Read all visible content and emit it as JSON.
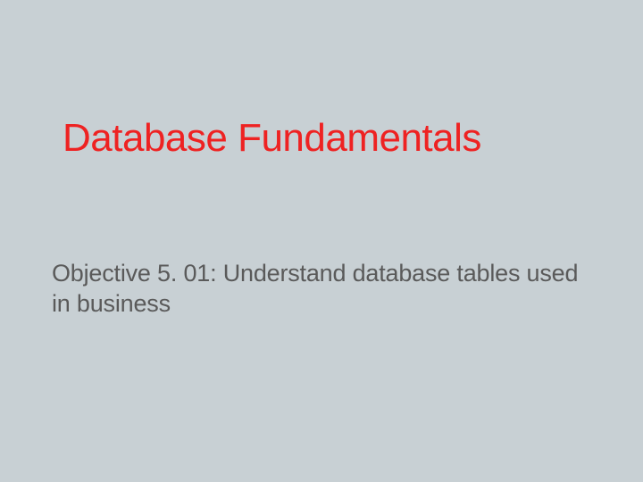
{
  "slide": {
    "title": "Database Fundamentals",
    "subtitle": "Objective 5. 01:  Understand database tables used in business"
  }
}
